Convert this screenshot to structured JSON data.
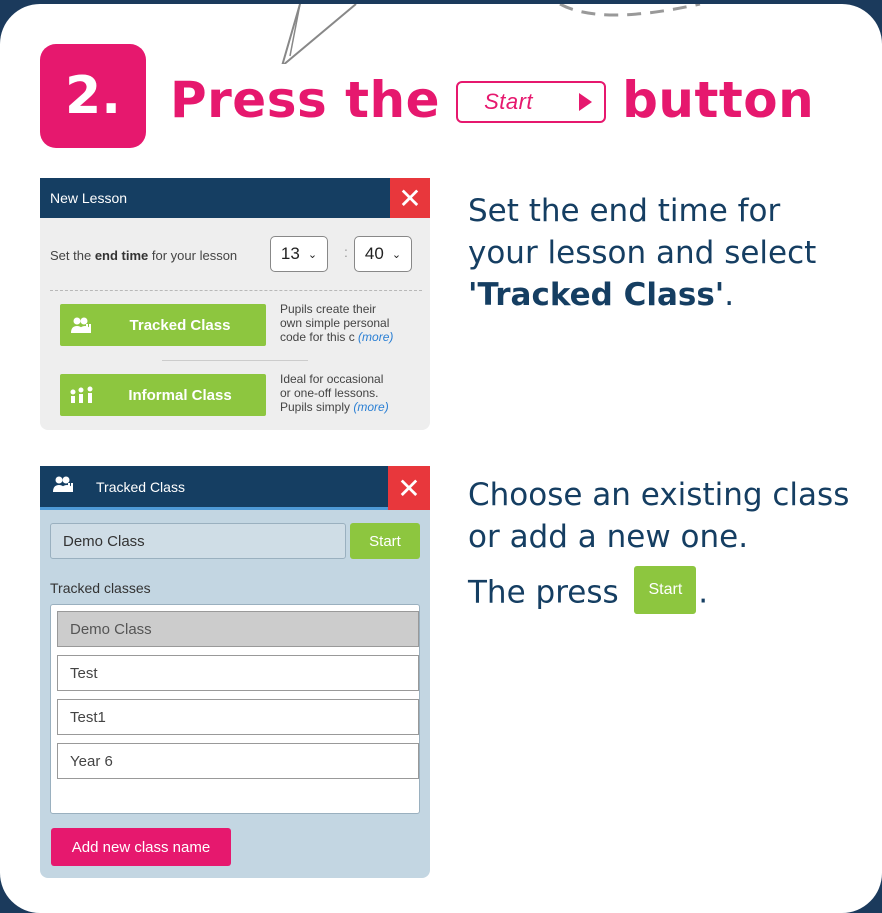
{
  "heading": {
    "step_number": "2.",
    "text_before": "Press the",
    "chip_label": "Start",
    "text_after": "button"
  },
  "new_lesson": {
    "title": "New Lesson",
    "close": "✕",
    "end_time_prefix": "Set the ",
    "end_time_bold": "end time",
    "end_time_suffix": " for your lesson",
    "hour": "13",
    "colon": ":",
    "minute": "40",
    "tracked": {
      "label": "Tracked Class",
      "desc_line1": "Pupils create their",
      "desc_line2": "own simple personal",
      "desc_line3": "code for this c",
      "more": "(more)"
    },
    "informal": {
      "label": "Informal Class",
      "desc_line1": "Ideal for occasional",
      "desc_line2": "or one-off lessons.",
      "desc_line3": "Pupils simply",
      "more": "(more)"
    }
  },
  "instruction1": {
    "text": "Set the end time for your lesson and select ",
    "bold": "'Tracked Class'",
    "end": "."
  },
  "tracked_panel": {
    "title": "Tracked Class",
    "close": "✕",
    "input_value": "Demo Class",
    "start_label": "Start",
    "list_label": "Tracked classes",
    "classes": [
      "Demo Class",
      "Test",
      "Test1",
      "Year 6"
    ],
    "add_label": "Add new class name"
  },
  "instruction2": {
    "line1": "Choose an existing class or add a new one.",
    "press_text": "The press ",
    "start_label": "Start",
    "end": "."
  },
  "colors": {
    "navy": "#153e62",
    "pink": "#e6186e",
    "green": "#8dc63f",
    "red": "#e8373c",
    "background": "#1b3a5c"
  }
}
